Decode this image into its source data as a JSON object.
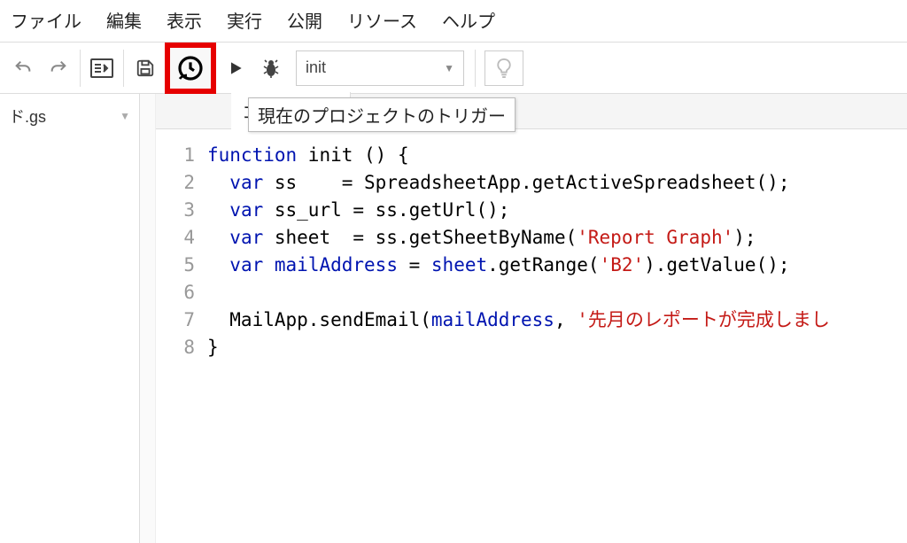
{
  "menu": [
    "ファイル",
    "編集",
    "表示",
    "実行",
    "公開",
    "リソース",
    "ヘルプ"
  ],
  "toolbar": {
    "selected_function": "init",
    "tooltip": "現在のプロジェクトのトリガー"
  },
  "sidebar": {
    "file_label": "ド.gs"
  },
  "tabs": {
    "active": "コード.gs"
  },
  "editor": {
    "line_count": 8,
    "lines": [
      [
        {
          "t": "kw",
          "v": "function"
        },
        {
          "t": "p",
          "v": " init () {"
        }
      ],
      [
        {
          "t": "p",
          "v": "  "
        },
        {
          "t": "kw",
          "v": "var"
        },
        {
          "t": "p",
          "v": " ss    = SpreadsheetApp.getActiveSpreadsheet();"
        }
      ],
      [
        {
          "t": "p",
          "v": "  "
        },
        {
          "t": "kw",
          "v": "var"
        },
        {
          "t": "p",
          "v": " ss_url = ss.getUrl();"
        }
      ],
      [
        {
          "t": "p",
          "v": "  "
        },
        {
          "t": "kw",
          "v": "var"
        },
        {
          "t": "p",
          "v": " sheet  = ss.getSheetByName("
        },
        {
          "t": "str",
          "v": "'Report Graph'"
        },
        {
          "t": "p",
          "v": ");"
        }
      ],
      [
        {
          "t": "p",
          "v": "  "
        },
        {
          "t": "kw",
          "v": "var"
        },
        {
          "t": "p",
          "v": " "
        },
        {
          "t": "ident",
          "v": "mailAddress"
        },
        {
          "t": "p",
          "v": " = "
        },
        {
          "t": "ident",
          "v": "sheet"
        },
        {
          "t": "p",
          "v": ".getRange("
        },
        {
          "t": "str",
          "v": "'B2'"
        },
        {
          "t": "p",
          "v": ").getValue();"
        }
      ],
      [
        {
          "t": "p",
          "v": ""
        }
      ],
      [
        {
          "t": "p",
          "v": "  MailApp.sendEmail("
        },
        {
          "t": "ident",
          "v": "mailAddress"
        },
        {
          "t": "p",
          "v": ", "
        },
        {
          "t": "str",
          "v": "'先月のレポートが完成しまし"
        }
      ],
      [
        {
          "t": "p",
          "v": "}"
        }
      ]
    ]
  }
}
